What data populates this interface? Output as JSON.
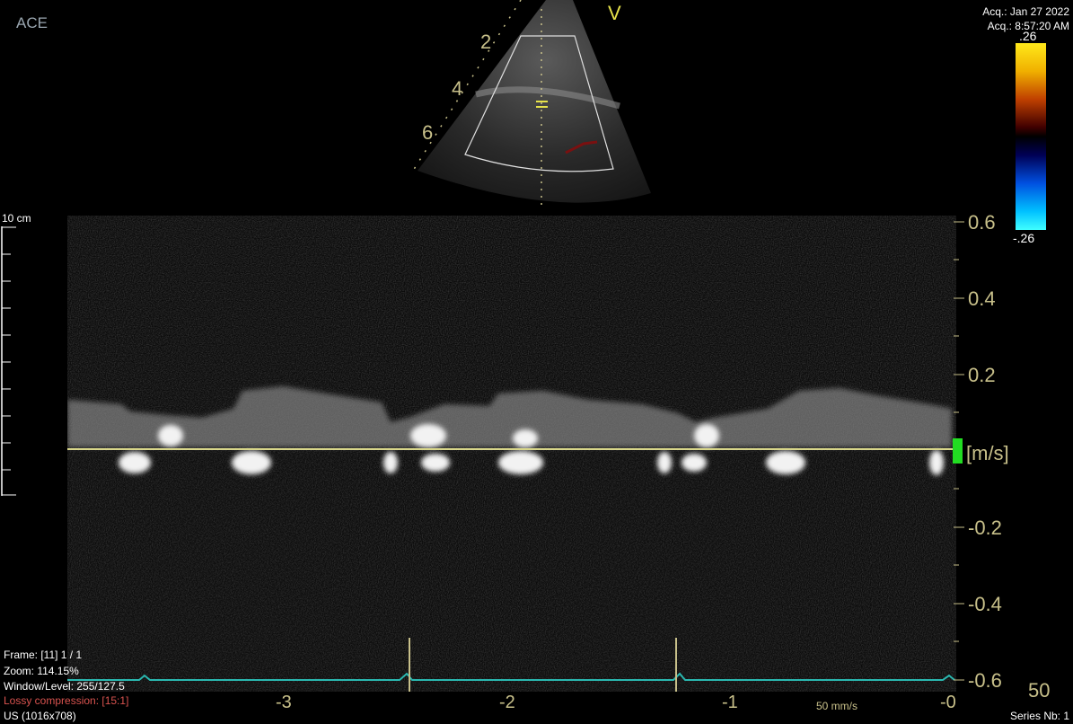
{
  "viewer": {
    "app_label": "ACE",
    "acq_date": "Acq.: Jan 27 2022",
    "acq_time": "Acq.: 8:57:20 AM",
    "frame": "Frame: [11] 1 / 1",
    "zoom": "Zoom: 114.15%",
    "window_level": "Window/Level: 255/127.5",
    "lossy": "Lossy compression: [15:1]",
    "modality": "US (1016x708)",
    "series": "Series Nb: 1",
    "colors": {
      "lossy": "#d9534f",
      "accent_yellow": "#e6e24a",
      "axis_olive": "#c8c08a",
      "ecg": "#2ab8b0",
      "baseline_marker": "#22dd22"
    }
  },
  "sector": {
    "orientation_marker": "V",
    "depth_labels": [
      "2",
      "4",
      "6"
    ]
  },
  "colorbar": {
    "top_label": ".26",
    "bottom_label": "-.26"
  },
  "depth_scale": {
    "label": "10 cm"
  },
  "spectral": {
    "velocity_ticks": [
      "0.6",
      "0.4",
      "0.2",
      "-0.2",
      "-0.4",
      "-0.6"
    ],
    "unit": "[m/s]",
    "time_ticks": [
      "-3",
      "-2",
      "-1",
      "-0"
    ],
    "sweep_speed": "50 mm/s",
    "gain": "50"
  }
}
